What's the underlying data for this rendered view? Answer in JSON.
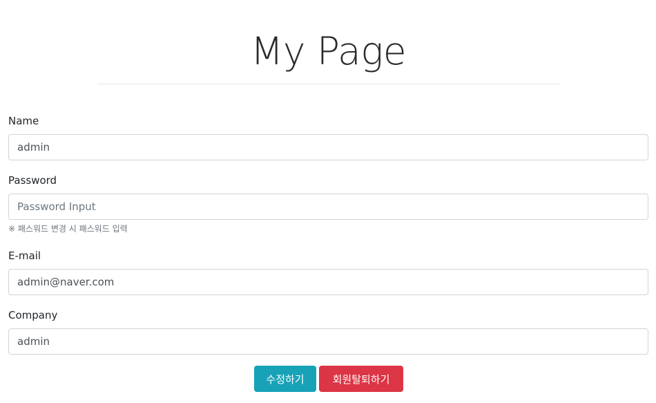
{
  "header": {
    "title": "My Page"
  },
  "form": {
    "name": {
      "label": "Name",
      "value": "admin"
    },
    "password": {
      "label": "Password",
      "value": "",
      "placeholder": "Password Input",
      "hint": "※ 패스워드 변경 시 패스워드 입력"
    },
    "email": {
      "label": "E-mail",
      "value": "admin@naver.com"
    },
    "company": {
      "label": "Company",
      "value": "admin"
    }
  },
  "actions": {
    "edit_label": "수정하기",
    "withdraw_label": "회원탈퇴하기"
  },
  "colors": {
    "edit_button": "#17a2b8",
    "withdraw_button": "#dc3545"
  }
}
